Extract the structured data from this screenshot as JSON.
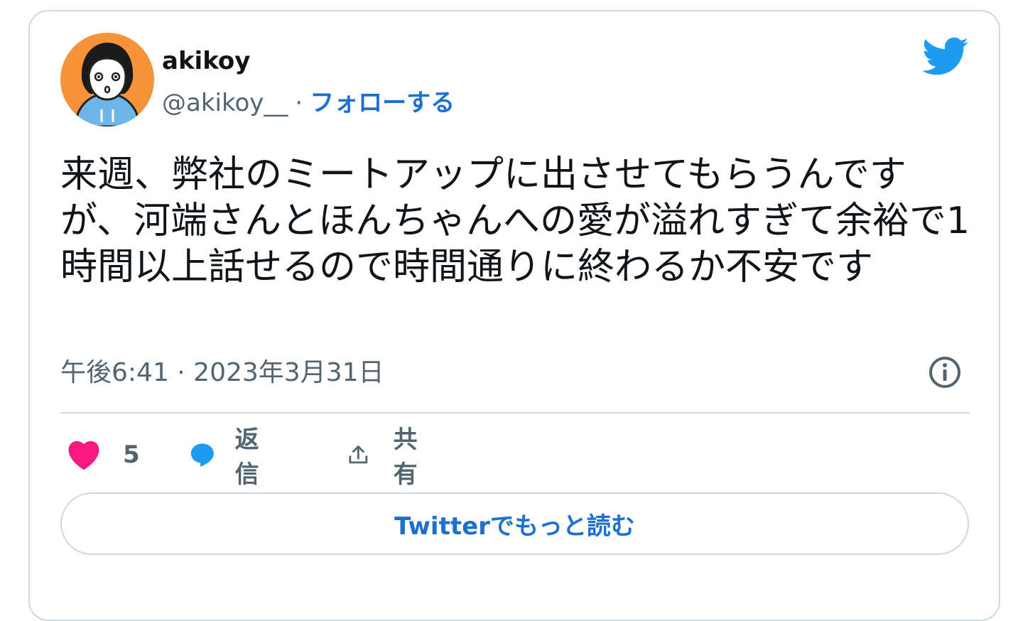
{
  "user": {
    "display_name": "akikoy",
    "handle": "@akikoy__",
    "separator": "·",
    "follow_label": "フォローする"
  },
  "tweet": {
    "text": "来週、弊社のミートアップに出させてもらうんですが、河端さんとほんちゃんへの愛が溢れすぎて余裕で1時間以上話せるので時間通りに終わるか不安です",
    "timestamp": "午後6:41 · 2023年3月31日"
  },
  "actions": {
    "like_count": "5",
    "reply_label": "返信",
    "share_label": "共有"
  },
  "read_more_label": "Twitterでもっと読む",
  "icons": {
    "logo": "twitter-bird-icon",
    "info": "info-icon",
    "like": "heart-icon",
    "reply": "speech-bubble-icon",
    "share": "share-upload-icon"
  },
  "colors": {
    "accent": "#1d6fd0",
    "twitter_blue": "#1d9bf0",
    "like_pink": "#f91880",
    "muted": "#536471",
    "avatar_bg": "#f6923a"
  }
}
